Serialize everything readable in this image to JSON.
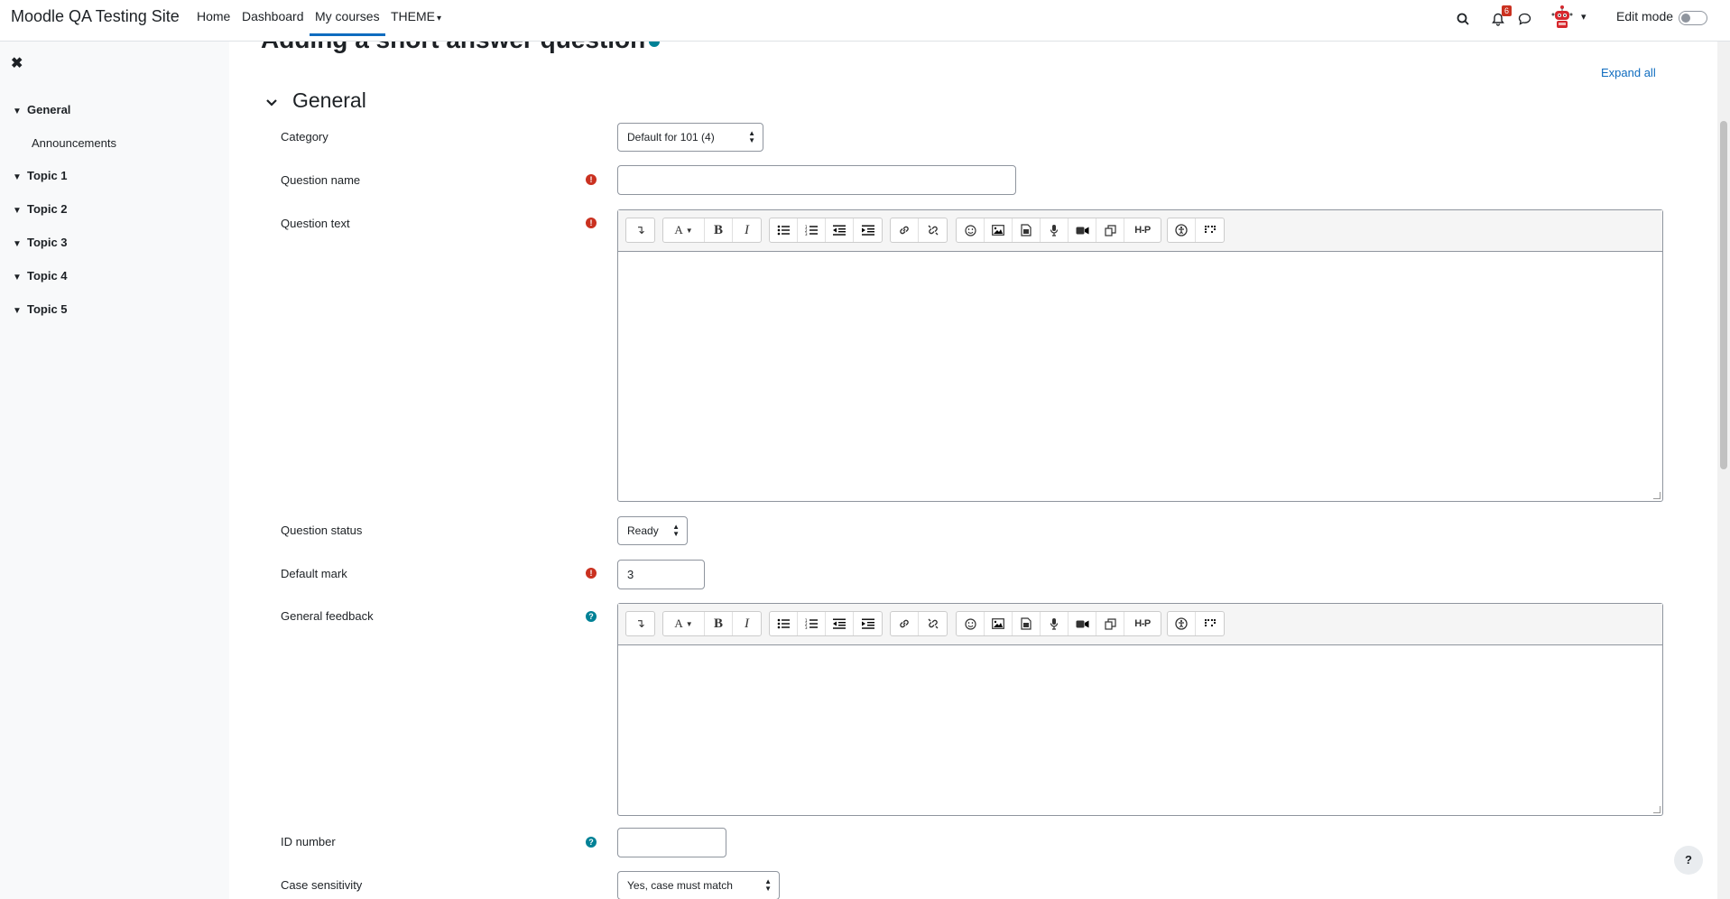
{
  "navbar": {
    "brand": "Moodle QA Testing Site",
    "links": [
      "Home",
      "Dashboard",
      "My courses",
      "THEME"
    ],
    "notification_count": "6",
    "edit_mode_label": "Edit mode"
  },
  "drawer": {
    "sections": [
      {
        "label": "General",
        "activities": [
          "Announcements"
        ]
      },
      {
        "label": "Topic 1"
      },
      {
        "label": "Topic 2"
      },
      {
        "label": "Topic 3"
      },
      {
        "label": "Topic 4"
      },
      {
        "label": "Topic 5"
      }
    ]
  },
  "page": {
    "heading": "Adding a short answer question",
    "expand_all": "Expand all",
    "fieldset_title": "General"
  },
  "form": {
    "category": {
      "label": "Category",
      "value": "Default for 101 (4)"
    },
    "question_name": {
      "label": "Question name",
      "value": ""
    },
    "question_text": {
      "label": "Question text"
    },
    "question_status": {
      "label": "Question status",
      "value": "Ready"
    },
    "default_mark": {
      "label": "Default mark",
      "value": "3"
    },
    "general_feedback": {
      "label": "General feedback"
    },
    "id_number": {
      "label": "ID number",
      "value": ""
    },
    "case_sensitivity": {
      "label": "Case sensitivity",
      "value": "Yes, case must match"
    }
  },
  "editor_toolbar": {
    "bold": "B",
    "italic": "I",
    "h5p": "H-P"
  },
  "icons": {
    "required": "exclamation-circle-icon",
    "help": "question-circle-icon"
  },
  "colors": {
    "link": "#0f6cbf",
    "required": "#ca3120",
    "help": "#008196"
  },
  "footer": {
    "help_button": "?"
  }
}
